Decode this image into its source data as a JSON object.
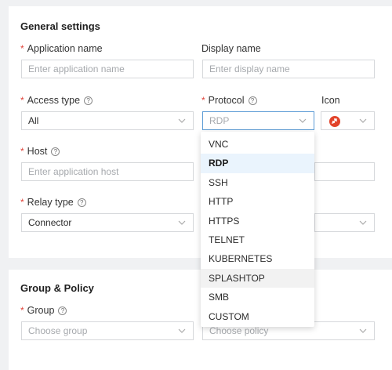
{
  "general": {
    "title": "General settings",
    "app_name_label": "Application name",
    "app_name_placeholder": "Enter application name",
    "display_name_label": "Display name",
    "display_name_placeholder": "Enter display name",
    "access_type_label": "Access type",
    "access_type_value": "All",
    "protocol_label": "Protocol",
    "protocol_value": "RDP",
    "icon_label": "Icon",
    "host_label": "Host",
    "host_placeholder": "Enter application host",
    "relay_type_label": "Relay type",
    "relay_type_value": "Connector",
    "required_mark": "*",
    "help_glyph": "?"
  },
  "protocol_options": [
    "VNC",
    "RDP",
    "SSH",
    "HTTP",
    "HTTPS",
    "TELNET",
    "KUBERNETES",
    "SPLASHTOP",
    "SMB",
    "CUSTOM"
  ],
  "selected_protocol": "RDP",
  "hovered_protocol": "SPLASHTOP",
  "group_policy": {
    "title": "Group & Policy",
    "group_label": "Group",
    "group_placeholder": "Choose group",
    "policy_placeholder": "Choose policy"
  },
  "colors": {
    "required": "#e0443a",
    "selected_bg": "#eaf4fd",
    "rdp_icon": "#e2432a"
  }
}
